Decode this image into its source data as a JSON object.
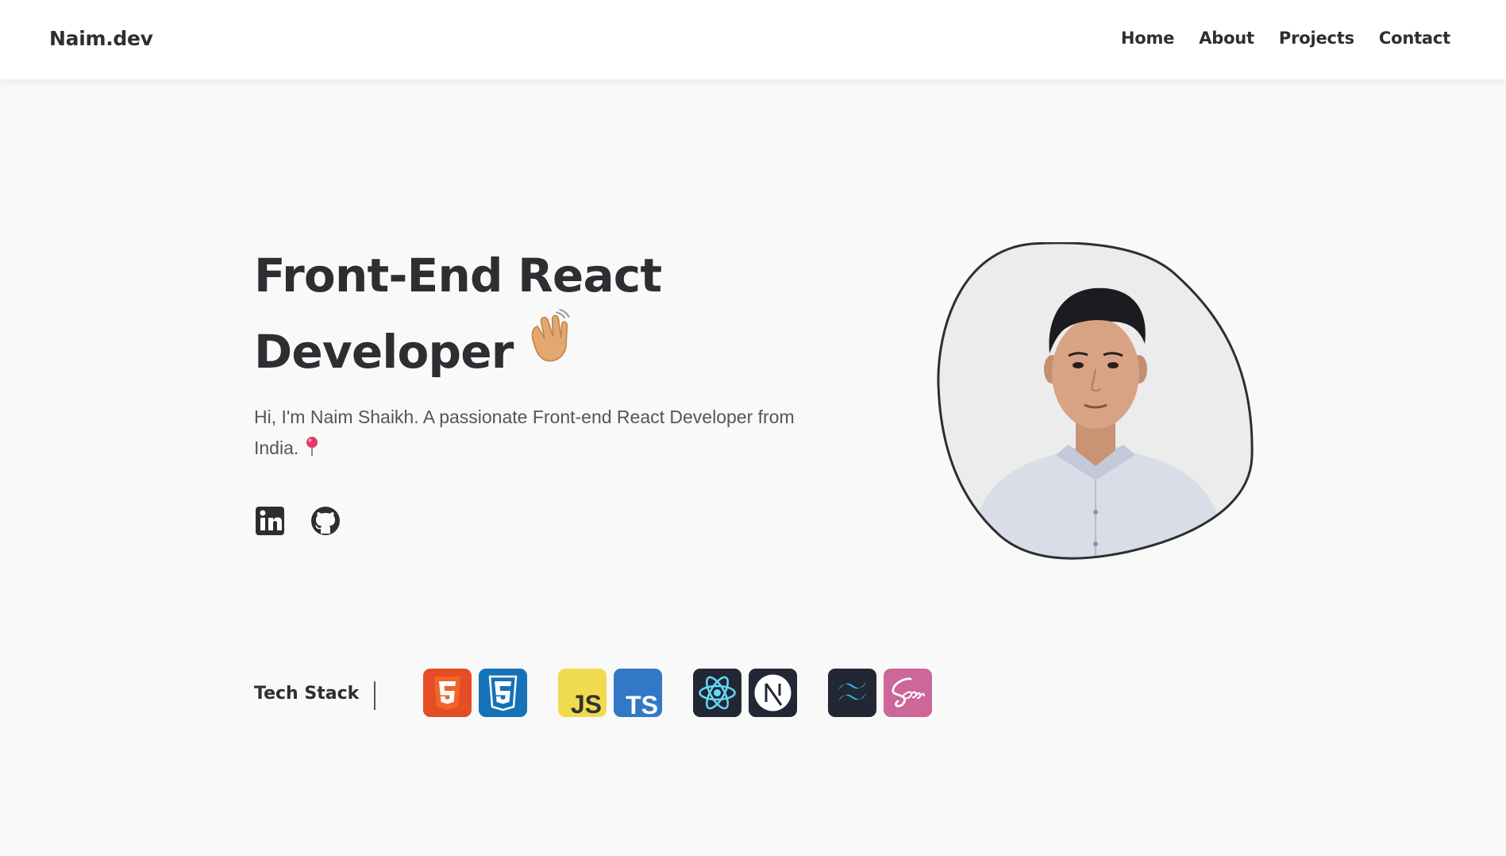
{
  "header": {
    "brand": "Naim.dev",
    "nav": [
      "Home",
      "About",
      "Projects",
      "Contact"
    ]
  },
  "hero": {
    "title_line1": "Front-End React",
    "title_line2": "Developer",
    "wave_icon": "waving-hand-icon",
    "intro": "Hi, I'm Naim Shaikh. A passionate Front-end React Developer from India.",
    "pin_icon": "round-pushpin-icon",
    "socials": [
      {
        "name": "linkedin-icon"
      },
      {
        "name": "github-icon"
      }
    ]
  },
  "portrait": {
    "alt": "profile-photo"
  },
  "tech_stack": {
    "label": "Tech Stack",
    "icons": [
      {
        "name": "html5-icon",
        "color": "#e44d26"
      },
      {
        "name": "css3-icon",
        "color": "#1572b6"
      },
      {
        "name": "javascript-icon",
        "color": "#f0db4f",
        "text": "JS"
      },
      {
        "name": "typescript-icon",
        "color": "#3178c6",
        "text": "TS"
      },
      {
        "name": "react-icon",
        "color": "#222833"
      },
      {
        "name": "nextjs-icon",
        "color": "#222833"
      },
      {
        "name": "tailwind-icon",
        "color": "#222833"
      },
      {
        "name": "sass-icon",
        "color": "#cd6799"
      }
    ]
  },
  "colors": {
    "background": "#f9f9f9",
    "text": "#2d2e32",
    "accent_react": "#61dafb",
    "accent_tailwind": "#38bdf8"
  }
}
